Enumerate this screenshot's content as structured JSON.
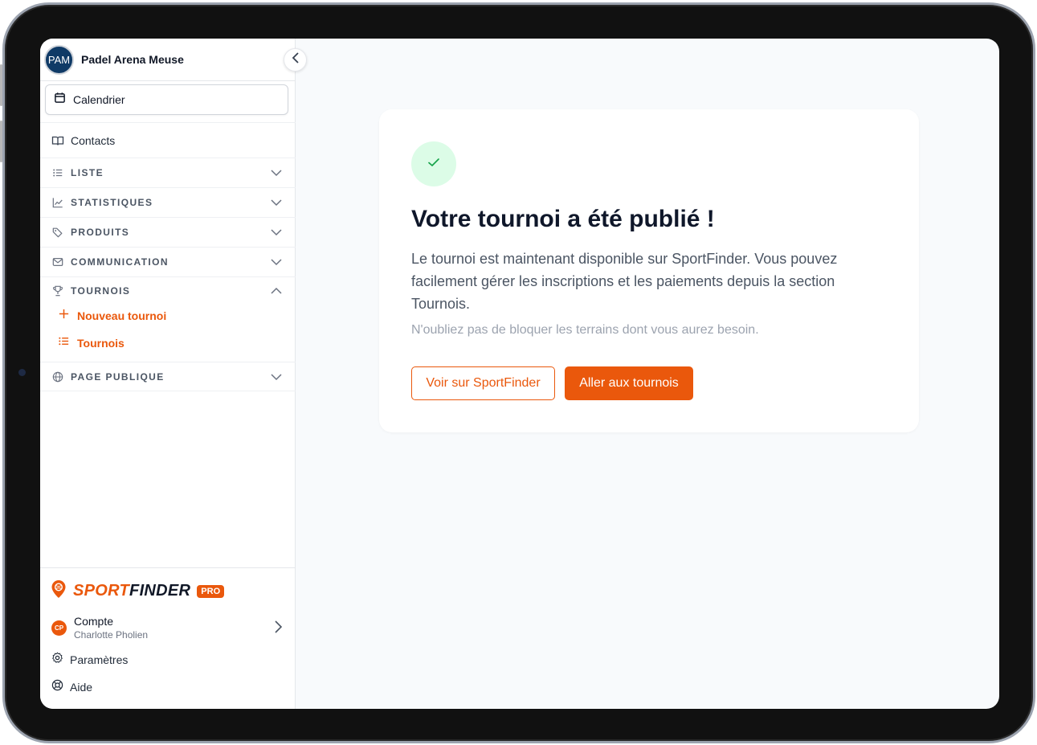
{
  "org": {
    "initials": "PAM",
    "name": "Padel Arena Meuse"
  },
  "sidebar": {
    "calendar_label": "Calendrier",
    "contacts_label": "Contacts",
    "sections": [
      {
        "label": "LISTE",
        "icon": "list-icon",
        "expanded": false
      },
      {
        "label": "STATISTIQUES",
        "icon": "chart-icon",
        "expanded": false
      },
      {
        "label": "PRODUITS",
        "icon": "tag-icon",
        "expanded": false
      },
      {
        "label": "COMMUNICATION",
        "icon": "mail-icon",
        "expanded": false
      },
      {
        "label": "TOURNOIS",
        "icon": "trophy-icon",
        "expanded": true
      },
      {
        "label": "PAGE PUBLIQUE",
        "icon": "globe-icon",
        "expanded": false
      }
    ],
    "tournois_items": [
      {
        "label": "Nouveau tournoi",
        "icon": "plus-icon"
      },
      {
        "label": "Tournois",
        "icon": "list-icon"
      }
    ]
  },
  "footer": {
    "logo_sport": "SPORT",
    "logo_finder": "FINDER",
    "pro_badge": "PRO",
    "account": {
      "initials": "CP",
      "title": "Compte",
      "user": "Charlotte Pholien"
    },
    "settings_label": "Paramètres",
    "help_label": "Aide"
  },
  "main": {
    "title": "Votre tournoi a été publié !",
    "description": "Le tournoi est maintenant disponible sur SportFinder. Vous pouvez facilement gérer les inscriptions et les paiements depuis la section Tournois.",
    "note": "N'oubliez pas de bloquer les terrains dont vous aurez besoin.",
    "secondary_button": "Voir sur SportFinder",
    "primary_button": "Aller aux tournois"
  },
  "colors": {
    "accent": "#ea580c",
    "avatar_bg": "#0f3a66",
    "success_bg": "#dcfce7",
    "success_icon": "#16a34a"
  }
}
